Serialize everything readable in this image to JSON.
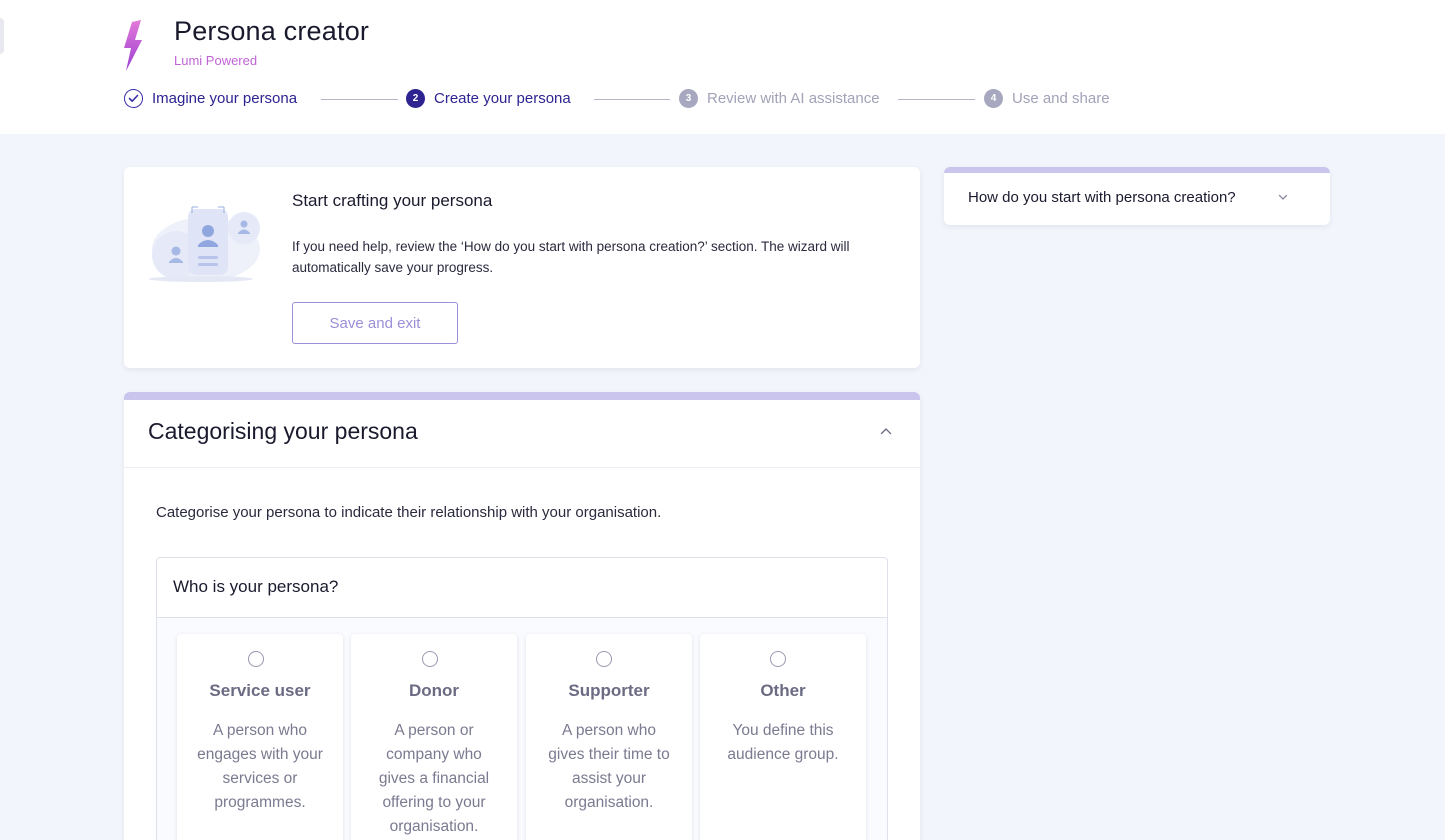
{
  "app": {
    "title": "Persona creator",
    "subtitle": "Lumi Powered"
  },
  "steps": [
    {
      "label": "Imagine your persona",
      "state": "done"
    },
    {
      "number": "2",
      "label": "Create your persona",
      "state": "current"
    },
    {
      "number": "3",
      "label": "Review with AI assistance",
      "state": "todo"
    },
    {
      "number": "4",
      "label": "Use and share",
      "state": "todo"
    }
  ],
  "intro": {
    "title": "Start crafting your persona",
    "text": "If you need help, review the ‘How do you start with persona creation?’ section. The wizard will automatically save your progress.",
    "save_label": "Save and exit"
  },
  "help_accordion": {
    "label": "How do you start with persona creation?"
  },
  "categorising": {
    "title": "Categorising your persona",
    "description": "Categorise your persona to indicate their relationship with your organisation.",
    "question": "Who is your persona?",
    "options": [
      {
        "title": "Service user",
        "description": "A person who engages with your services or programmes."
      },
      {
        "title": "Donor",
        "description": "A person or company who gives a financial offering to your organisation."
      },
      {
        "title": "Supporter",
        "description": "A person who gives their time to assist your organisation."
      },
      {
        "title": "Other",
        "description": "You define this audience group."
      }
    ]
  },
  "colors": {
    "brand": "#2d2391",
    "accent_pink": "#c064d6",
    "button_outline": "#9b8fd8",
    "card_topbar": "#c9c5ec",
    "page_bg": "#f3f5fc"
  },
  "icons": [
    "lightning-logo-icon",
    "check-icon",
    "chevron-down-icon",
    "chevron-up-icon",
    "persona-illustration"
  ]
}
